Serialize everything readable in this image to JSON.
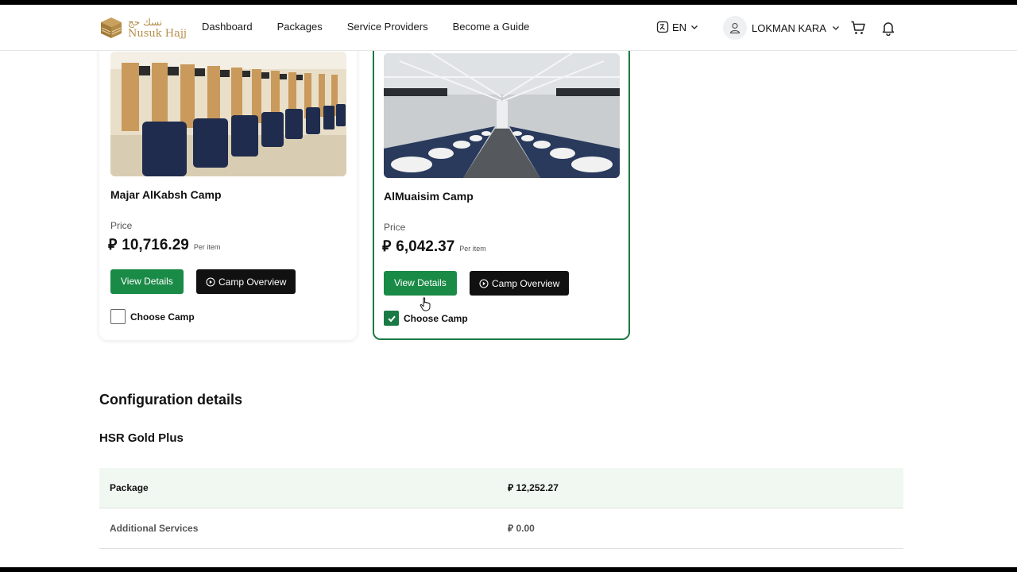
{
  "header": {
    "logo_ar": "نسك حج",
    "logo_en": "Nusuk Hajj",
    "nav": [
      "Dashboard",
      "Packages",
      "Service Providers",
      "Become a Guide"
    ],
    "lang": "EN",
    "user_name": "LOKMAN KARA"
  },
  "currency_symbol": "⃁",
  "camps": [
    {
      "title": "Majar AlKabsh Camp",
      "price_label": "Price",
      "price": "10,716.29",
      "per_item": "Per item",
      "view_details": "View Details",
      "overview": "Camp Overview",
      "choose": "Choose Camp",
      "selected": false
    },
    {
      "title": "AlMuaisim Camp",
      "price_label": "Price",
      "price": "6,042.37",
      "per_item": "Per item",
      "view_details": "View Details",
      "overview": "Camp Overview",
      "choose": "Choose Camp",
      "selected": true
    }
  ],
  "config": {
    "title": "Configuration details",
    "subtitle": "HSR Gold Plus",
    "rows": [
      {
        "label": "Package",
        "value": "12,252.27"
      },
      {
        "label": "Additional Services",
        "value": "0.00"
      }
    ]
  },
  "colors": {
    "primary_green": "#1a8a47",
    "selected_border": "#1a7a45",
    "logo_gold": "#b38b45"
  }
}
